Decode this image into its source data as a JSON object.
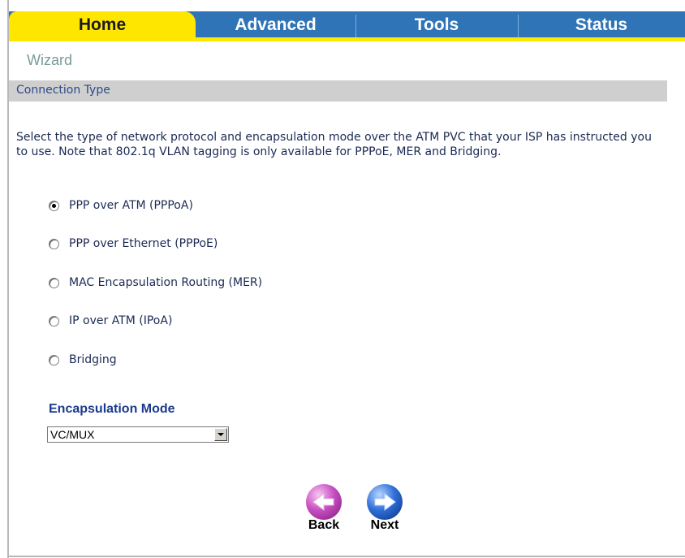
{
  "tabs": [
    {
      "label": "Home",
      "active": true
    },
    {
      "label": "Advanced",
      "active": false
    },
    {
      "label": "Tools",
      "active": false
    },
    {
      "label": "Status",
      "active": false
    }
  ],
  "page": {
    "title": "Wizard",
    "section_title": "Connection Type",
    "description": "Select the type of network protocol and encapsulation mode over the ATM PVC that your ISP has instructed you to use. Note that 802.1q VLAN tagging is only available for PPPoE, MER and Bridging."
  },
  "connection_types": [
    {
      "label": "PPP over ATM (PPPoA)",
      "checked": true
    },
    {
      "label": "PPP over Ethernet (PPPoE)",
      "checked": false
    },
    {
      "label": "MAC Encapsulation Routing (MER)",
      "checked": false
    },
    {
      "label": "IP over ATM (IPoA)",
      "checked": false
    },
    {
      "label": "Bridging",
      "checked": false
    }
  ],
  "encapsulation": {
    "label": "Encapsulation Mode",
    "selected": "VC/MUX"
  },
  "nav": {
    "back_label": "Back",
    "next_label": "Next",
    "back_icon": "left-arrow-icon",
    "next_icon": "right-arrow-icon"
  },
  "colors": {
    "active_tab": "#ffe600",
    "tab": "#2f74b6",
    "section_bar": "#cfcfcf",
    "text": "#1b2a55"
  }
}
